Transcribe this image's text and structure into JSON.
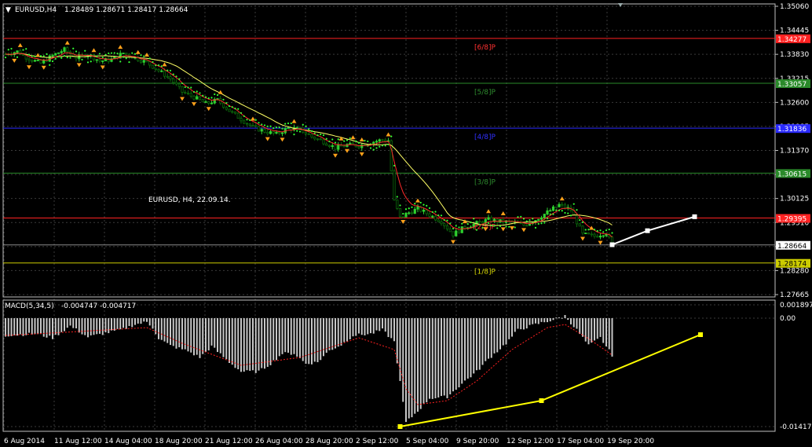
{
  "header": {
    "symbol": "EURUSD,H4",
    "quote": "1.28489 1.28671 1.28417 1.28664"
  },
  "annotation_title": "EURUSD, H4, 22.09.14.",
  "macd_header": {
    "name": "MACD(5,34,5)",
    "values": "-0.004747 -0.004717"
  },
  "colors": {
    "background": "#000000",
    "grid": "#3a3a3a",
    "bull": "#2fd12f",
    "bear": "#0b6b0b",
    "fractal": "#ffa11a",
    "sma": "#ffff66",
    "ema": "#ff2a2a",
    "psar": "#33ff33",
    "histogram": "#c8c8c8",
    "signal": "#ff2020",
    "trend": "#ffff00",
    "forecast": "#ffffff"
  },
  "chart_data": [
    {
      "type": "candlestick",
      "title": "EURUSD,H4",
      "ylim": [
        1.2725,
        1.3517
      ],
      "price_ticks": [
        "1.35060",
        "1.34445",
        "1.33830",
        "1.33215",
        "1.32600",
        "1.31985",
        "1.31370",
        "1.30740",
        "1.30125",
        "1.29510",
        "1.28899",
        "1.28280",
        "1.27665"
      ],
      "x_ticks": [
        "6 Aug 2014",
        "11 Aug 12:00",
        "14 Aug 04:00",
        "18 Aug 20:00",
        "21 Aug 12:00",
        "26 Aug 04:00",
        "28 Aug 20:00",
        "2 Sep 12:00",
        "5 Sep 04:00",
        "9 Sep 20:00",
        "12 Sep 12:00",
        "17 Sep 04:00",
        "19 Sep 20:00"
      ],
      "close_path": [
        [
          0,
          1.3385
        ],
        [
          4,
          1.3392
        ],
        [
          8,
          1.3372
        ],
        [
          12,
          1.336
        ],
        [
          16,
          1.3381
        ],
        [
          20,
          1.3397
        ],
        [
          24,
          1.3375
        ],
        [
          28,
          1.3385
        ],
        [
          32,
          1.3366
        ],
        [
          36,
          1.337
        ],
        [
          40,
          1.3388
        ],
        [
          44,
          1.3375
        ],
        [
          48,
          1.3362
        ],
        [
          52,
          1.334
        ],
        [
          56,
          1.3318
        ],
        [
          60,
          1.3282
        ],
        [
          64,
          1.3268
        ],
        [
          68,
          1.325
        ],
        [
          72,
          1.326
        ],
        [
          76,
          1.3231
        ],
        [
          80,
          1.3208
        ],
        [
          84,
          1.3186
        ],
        [
          88,
          1.3175
        ],
        [
          92,
          1.3167
        ],
        [
          96,
          1.3184
        ],
        [
          100,
          1.318
        ],
        [
          104,
          1.316
        ],
        [
          108,
          1.3147
        ],
        [
          112,
          1.313
        ],
        [
          116,
          1.3138
        ],
        [
          120,
          1.3136
        ],
        [
          124,
          1.3145
        ],
        [
          128,
          1.3152
        ],
        [
          130,
          1.315
        ],
        [
          132,
          1.2985
        ],
        [
          134,
          1.294
        ],
        [
          136,
          1.295
        ],
        [
          140,
          1.2965
        ],
        [
          144,
          1.2948
        ],
        [
          148,
          1.293
        ],
        [
          152,
          1.2895
        ],
        [
          156,
          1.2915
        ],
        [
          160,
          1.2925
        ],
        [
          164,
          1.2935
        ],
        [
          168,
          1.293
        ],
        [
          172,
          1.2928
        ],
        [
          176,
          1.292
        ],
        [
          180,
          1.2935
        ],
        [
          184,
          1.2955
        ],
        [
          188,
          1.2975
        ],
        [
          192,
          1.2962
        ],
        [
          196,
          1.2895
        ],
        [
          200,
          1.289
        ],
        [
          204,
          1.29
        ],
        [
          206,
          1.2866
        ]
      ],
      "lines": [
        {
          "name": "[6/8]P",
          "price": 1.34277,
          "label": "1.34277",
          "color": "#ff2222",
          "label_color": "#ff3030"
        },
        {
          "name": "[5/8]P",
          "price": 1.33057,
          "label": "1.33057",
          "color": "#2a8a2a",
          "label_color": "#2e8b2e"
        },
        {
          "name": "[4/8]P",
          "price": 1.31836,
          "label": "1.31836",
          "color": "#2a2aff",
          "label_color": "#3030ff"
        },
        {
          "name": "[3/8]P",
          "price": 1.30615,
          "label": "1.30615",
          "color": "#2a8a2a",
          "label_color": "#2e8b2e"
        },
        {
          "name": "[2/8]P",
          "price": 1.29395,
          "label": "1.29395",
          "color": "#ff2222",
          "label_color": "#ff3030"
        },
        {
          "name": "[1/8]P",
          "price": 1.28174,
          "label": "1.28174",
          "color": "#cccc00",
          "label_color": "#d4d400"
        }
      ],
      "current_price": {
        "value": 1.28664,
        "label": "1.28664"
      },
      "forecast": [
        [
          206,
          1.2867
        ],
        [
          218,
          1.2905
        ],
        [
          234,
          1.2943
        ]
      ]
    },
    {
      "type": "bar",
      "title": "MACD(5,34,5)",
      "ylim": [
        -0.0144,
        0.0023
      ],
      "value_ticks": [
        "0.001897",
        "0.00",
        "-0.014179"
      ],
      "histogram_path": [
        [
          0,
          -0.0022
        ],
        [
          10,
          -0.002
        ],
        [
          16,
          -0.0025
        ],
        [
          22,
          -0.001
        ],
        [
          28,
          -0.0024
        ],
        [
          40,
          -0.0014
        ],
        [
          44,
          -0.0008
        ],
        [
          48,
          -0.0005
        ],
        [
          50,
          -0.0012
        ],
        [
          52,
          -0.0026
        ],
        [
          56,
          -0.0035
        ],
        [
          62,
          -0.0042
        ],
        [
          66,
          -0.005
        ],
        [
          70,
          -0.0036
        ],
        [
          76,
          -0.0056
        ],
        [
          80,
          -0.0068
        ],
        [
          86,
          -0.0068
        ],
        [
          90,
          -0.0058
        ],
        [
          94,
          -0.0045
        ],
        [
          98,
          -0.0045
        ],
        [
          102,
          -0.0058
        ],
        [
          106,
          -0.0056
        ],
        [
          110,
          -0.0041
        ],
        [
          114,
          -0.0034
        ],
        [
          118,
          -0.0022
        ],
        [
          124,
          -0.002
        ],
        [
          128,
          -0.0015
        ],
        [
          132,
          -0.003
        ],
        [
          136,
          -0.0133
        ],
        [
          140,
          -0.0118
        ],
        [
          144,
          -0.0102
        ],
        [
          150,
          -0.01
        ],
        [
          156,
          -0.008
        ],
        [
          160,
          -0.0068
        ],
        [
          164,
          -0.0052
        ],
        [
          170,
          -0.0032
        ],
        [
          174,
          -0.0015
        ],
        [
          180,
          -0.0008
        ],
        [
          186,
          -0.0002
        ],
        [
          190,
          0.0003
        ],
        [
          194,
          -0.0015
        ],
        [
          198,
          -0.0035
        ],
        [
          202,
          -0.0025
        ],
        [
          206,
          -0.0047
        ]
      ],
      "signal_path": [
        [
          0,
          -0.0022
        ],
        [
          20,
          -0.0018
        ],
        [
          48,
          -0.0012
        ],
        [
          60,
          -0.0032
        ],
        [
          80,
          -0.006
        ],
        [
          100,
          -0.005
        ],
        [
          120,
          -0.0025
        ],
        [
          132,
          -0.004
        ],
        [
          136,
          -0.009
        ],
        [
          140,
          -0.011
        ],
        [
          150,
          -0.0105
        ],
        [
          160,
          -0.008
        ],
        [
          172,
          -0.004
        ],
        [
          184,
          -0.0012
        ],
        [
          190,
          -0.0008
        ],
        [
          198,
          -0.0026
        ],
        [
          206,
          -0.0047
        ]
      ],
      "trendline": [
        [
          134,
          -0.0138
        ],
        [
          182,
          -0.0105
        ],
        [
          236,
          -0.0021
        ]
      ]
    }
  ]
}
